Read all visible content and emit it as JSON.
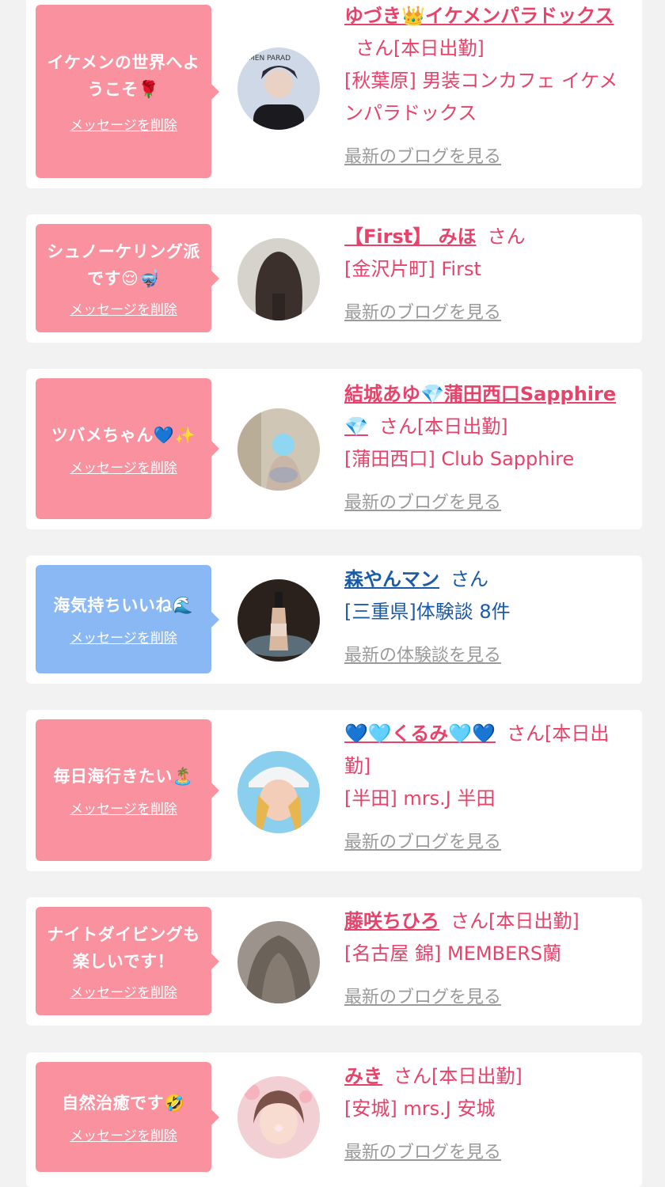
{
  "cards": [
    {
      "message": "イケメンの世界へようこそ🌹",
      "delete_label": "メッセージを削除",
      "name": "ゆづき👑イケメンパラドックス",
      "suffix": "さん[本日出勤]",
      "shop": "[秋葉原] 男装コンカフェ イケメンパラドックス",
      "blog_link": "最新のブログを見る",
      "avatar_text": "MEN PARAD"
    },
    {
      "message": "シュノーケリング派です😌🤿",
      "delete_label": "メッセージを削除",
      "name": "【First】 みほ",
      "suffix": "さん",
      "shop": "[金沢片町] First",
      "blog_link": "最新のブログを見る"
    },
    {
      "message": "ツバメちゃん💙✨",
      "delete_label": "メッセージを削除",
      "name": "結城あゆ💎蒲田西口Sapphire💎",
      "suffix": "さん[本日出勤]",
      "shop": "[蒲田西口] Club Sapphire",
      "blog_link": "最新のブログを見る"
    },
    {
      "message": "海気持ちいいね🌊",
      "delete_label": "メッセージを削除",
      "name": "森やんマン",
      "suffix": "さん",
      "shop": "[三重県]体験談 8件",
      "blog_link": "最新の体験談を見る"
    },
    {
      "message": "毎日海行きたい🏝️",
      "delete_label": "メッセージを削除",
      "name": "💙🩵くるみ🩵💙",
      "suffix": "さん[本日出勤]",
      "shop": "[半田] mrs.J 半田",
      "blog_link": "最新のブログを見る"
    },
    {
      "message": "ナイトダイビングも楽しいです！",
      "delete_label": "メッセージを削除",
      "name": "藤咲ちひろ",
      "suffix": "さん[本日出勤]",
      "shop": "[名古屋 錦] MEMBERS蘭",
      "blog_link": "最新のブログを見る"
    },
    {
      "message": "自然治癒です🤣",
      "delete_label": "メッセージを削除",
      "name": "みき",
      "suffix": "さん[本日出勤]",
      "shop": "[安城] mrs.J 安城",
      "blog_link": "最新のブログを見る"
    }
  ],
  "colors": {
    "pink_bubble": "#f9919f",
    "blue_bubble": "#8ab8f4",
    "pink_text": "#e8426a",
    "blue_text": "#1a5aa8",
    "link_gray": "#9a9a9a"
  }
}
